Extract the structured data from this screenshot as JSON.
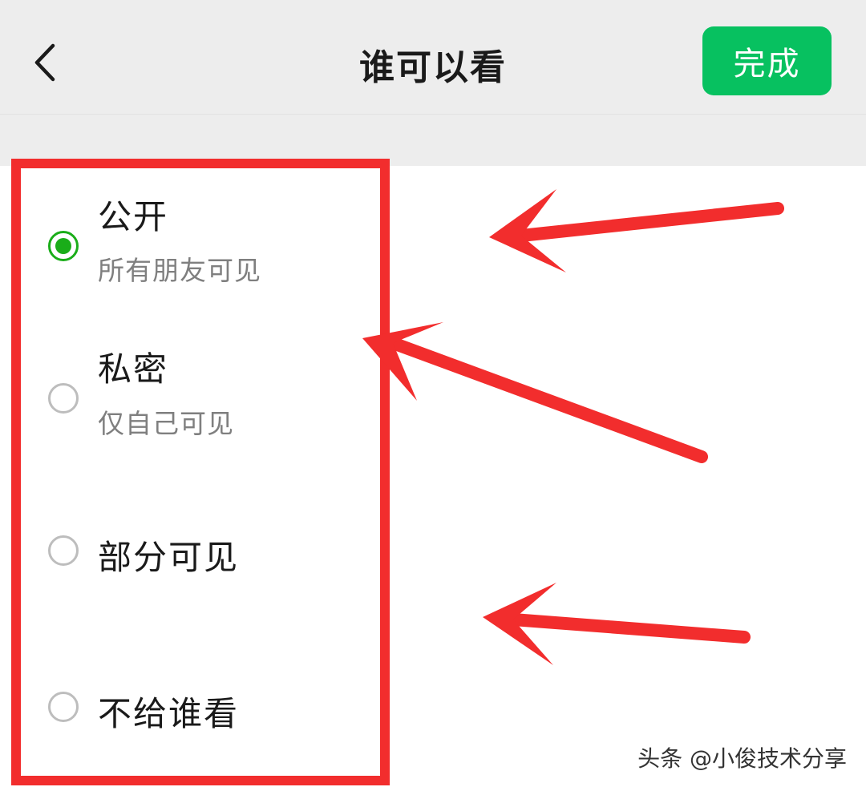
{
  "header": {
    "title": "谁可以看",
    "done_label": "完成",
    "back_icon": "chevron-left-icon"
  },
  "options": [
    {
      "label": "公开",
      "sublabel": "所有朋友可见",
      "selected": true
    },
    {
      "label": "私密",
      "sublabel": "仅自己可见",
      "selected": false
    },
    {
      "label": "部分可见",
      "sublabel": "",
      "selected": false
    },
    {
      "label": "不给谁看",
      "sublabel": "",
      "selected": false
    }
  ],
  "annotation": {
    "highlight_color": "#f22d2d",
    "arrow_color": "#f22d2d"
  },
  "watermark": "头条 @小俊技术分享",
  "colors": {
    "accent": "#07c160",
    "radio_checked": "#1aad19",
    "header_bg": "#ededed"
  }
}
